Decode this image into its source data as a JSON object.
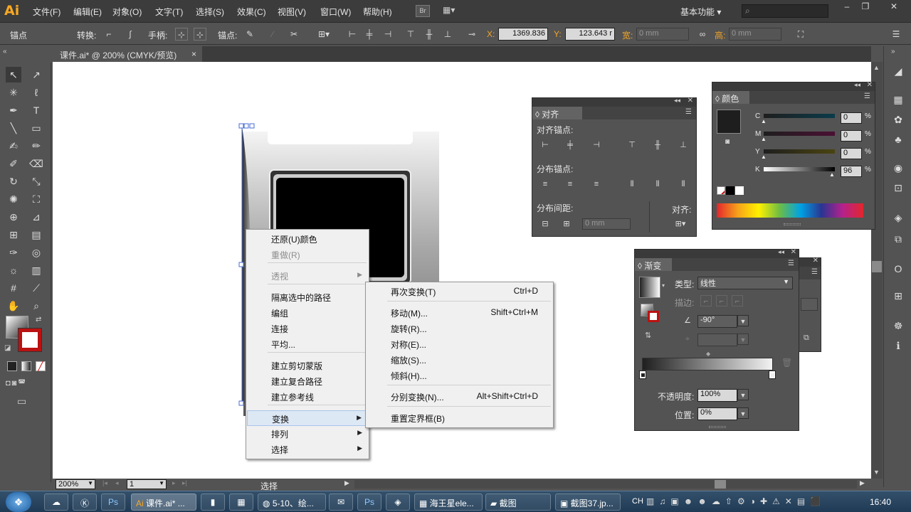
{
  "app": {
    "logo": "Ai",
    "br_label": "Br",
    "workspace": "基本功能",
    "search_placeholder": ""
  },
  "menubar": [
    "文件(F)",
    "编辑(E)",
    "对象(O)",
    "文字(T)",
    "选择(S)",
    "效果(C)",
    "视图(V)",
    "窗口(W)",
    "帮助(H)"
  ],
  "controlbar": {
    "mode": "锚点",
    "convert": "转换:",
    "handles": "手柄:",
    "anchors": "锚点:",
    "x_label": "X:",
    "x_value": "1369.836",
    "y_label": "Y:",
    "y_value": "123.643 r",
    "w_label": "宽:",
    "w_value": "0 mm",
    "h_label": "高:",
    "h_value": "0 mm"
  },
  "document": {
    "tab": "课件.ai* @ 200% (CMYK/预览)",
    "close": "×"
  },
  "status": {
    "zoom": "200%",
    "page": "1",
    "tool": "选择"
  },
  "context_menu": {
    "items": [
      {
        "label": "还原(U)颜色",
        "disabled": false
      },
      {
        "label": "重做(R)",
        "disabled": true
      },
      {
        "label": "透视",
        "disabled": true,
        "submenu": true
      },
      {
        "label": "隔离选中的路径",
        "disabled": false
      },
      {
        "label": "编组",
        "disabled": false
      },
      {
        "label": "连接",
        "disabled": false
      },
      {
        "label": "平均...",
        "disabled": false
      },
      {
        "label": "建立剪切蒙版",
        "disabled": false
      },
      {
        "label": "建立复合路径",
        "disabled": false
      },
      {
        "label": "建立参考线",
        "disabled": false
      },
      {
        "label": "变换",
        "disabled": false,
        "submenu": true,
        "highlighted": true
      },
      {
        "label": "排列",
        "disabled": false,
        "submenu": true
      },
      {
        "label": "选择",
        "disabled": false,
        "submenu": true
      }
    ]
  },
  "transform_submenu": {
    "items": [
      {
        "label": "再次变换(T)",
        "shortcut": "Ctrl+D"
      },
      {
        "label": "移动(M)...",
        "shortcut": "Shift+Ctrl+M"
      },
      {
        "label": "旋转(R)...",
        "shortcut": ""
      },
      {
        "label": "对称(E)...",
        "shortcut": ""
      },
      {
        "label": "缩放(S)...",
        "shortcut": ""
      },
      {
        "label": "倾斜(H)...",
        "shortcut": ""
      },
      {
        "label": "分别变换(N)...",
        "shortcut": "Alt+Shift+Ctrl+D"
      },
      {
        "label": "重置定界框(B)",
        "shortcut": ""
      }
    ]
  },
  "align_panel": {
    "title": "对齐",
    "align_objects": "对齐锚点:",
    "distribute_objects": "分布锚点:",
    "distribute_spacing": "分布间距:",
    "align_to": "对齐:",
    "spacing_value": "0 mm"
  },
  "color_panel": {
    "title": "颜色",
    "channels": [
      {
        "name": "C",
        "value": "0",
        "unit": "%",
        "level": 0
      },
      {
        "name": "M",
        "value": "0",
        "unit": "%",
        "level": 0
      },
      {
        "name": "Y",
        "value": "0",
        "unit": "%",
        "level": 0
      },
      {
        "name": "K",
        "value": "96",
        "unit": "%",
        "level": 0.96
      }
    ]
  },
  "gradient_panel": {
    "title": "渐变",
    "type_label": "类型:",
    "type_value": "线性",
    "stroke_label": "描边:",
    "angle_value": "-90°",
    "opacity_label": "不透明度:",
    "opacity_value": "100%",
    "location_label": "位置:",
    "location_value": "0%"
  },
  "taskbar": {
    "items": [
      "课件.ai* ...",
      "5-10、绘...",
      "海王星ele...",
      "截图",
      "截图37.jp..."
    ],
    "lang": "CH",
    "clock": "16:40"
  },
  "colors": {
    "accent": "#f7a823",
    "selection": "#4a6cd4"
  }
}
